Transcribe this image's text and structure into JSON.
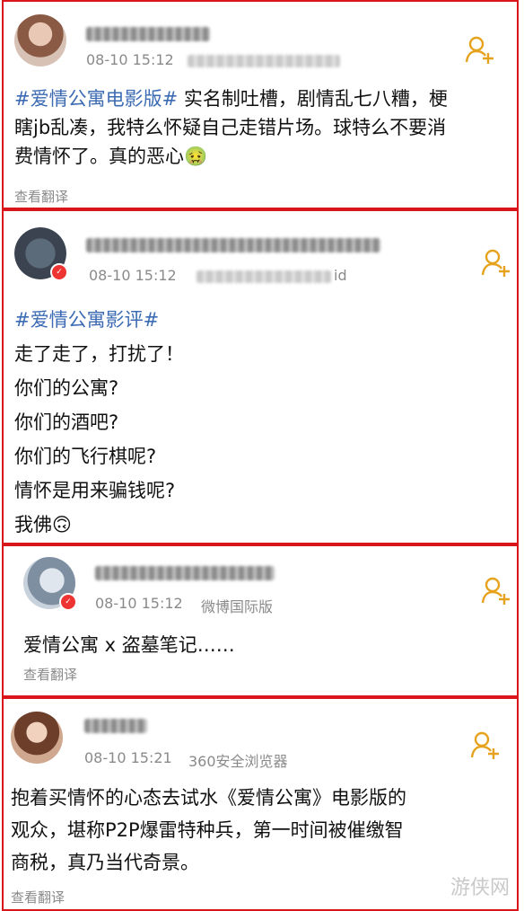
{
  "posts": [
    {
      "time": "08-10 15:12",
      "hashtag": "#爱情公寓电影版#",
      "lines": [
        "实名制吐槽，剧情乱七八糟，梗",
        "瞎jb乱凑，我特么怀疑自己走错片场。球特么不要消",
        "费情怀了。真的恶心🤢"
      ],
      "translate": "查看翻译"
    },
    {
      "time": "08-10 15:12",
      "source_tail": "id",
      "hashtag": "#爱情公寓影评#",
      "lines": [
        "走了走了，打扰了！",
        "你们的公寓?",
        "你们的酒吧?",
        "你们的飞行棋呢?",
        "情怀是用来骗钱呢?",
        "我佛🙃"
      ]
    },
    {
      "time": "08-10 15:12",
      "source": "微博国际版",
      "lines": [
        "爱情公寓 x 盗墓笔记……"
      ],
      "translate": "查看翻译"
    },
    {
      "time": "08-10 15:21",
      "source": "360安全浏览器",
      "lines": [
        "抱着买情怀的心态去试水《爱情公寓》电影版的",
        "观众，堪称P2P爆雷特种兵，第一时间被催缴智",
        "商税，真乃当代奇景。"
      ],
      "translate": "查看翻译"
    }
  ],
  "watermark": "游侠网",
  "colors": {
    "border": "#d9161c",
    "hashtag": "#3c6bb4",
    "follow_icon": "#e6a21c",
    "meta": "#8a8a8a"
  },
  "icons": {
    "follow": "add-user-icon"
  }
}
